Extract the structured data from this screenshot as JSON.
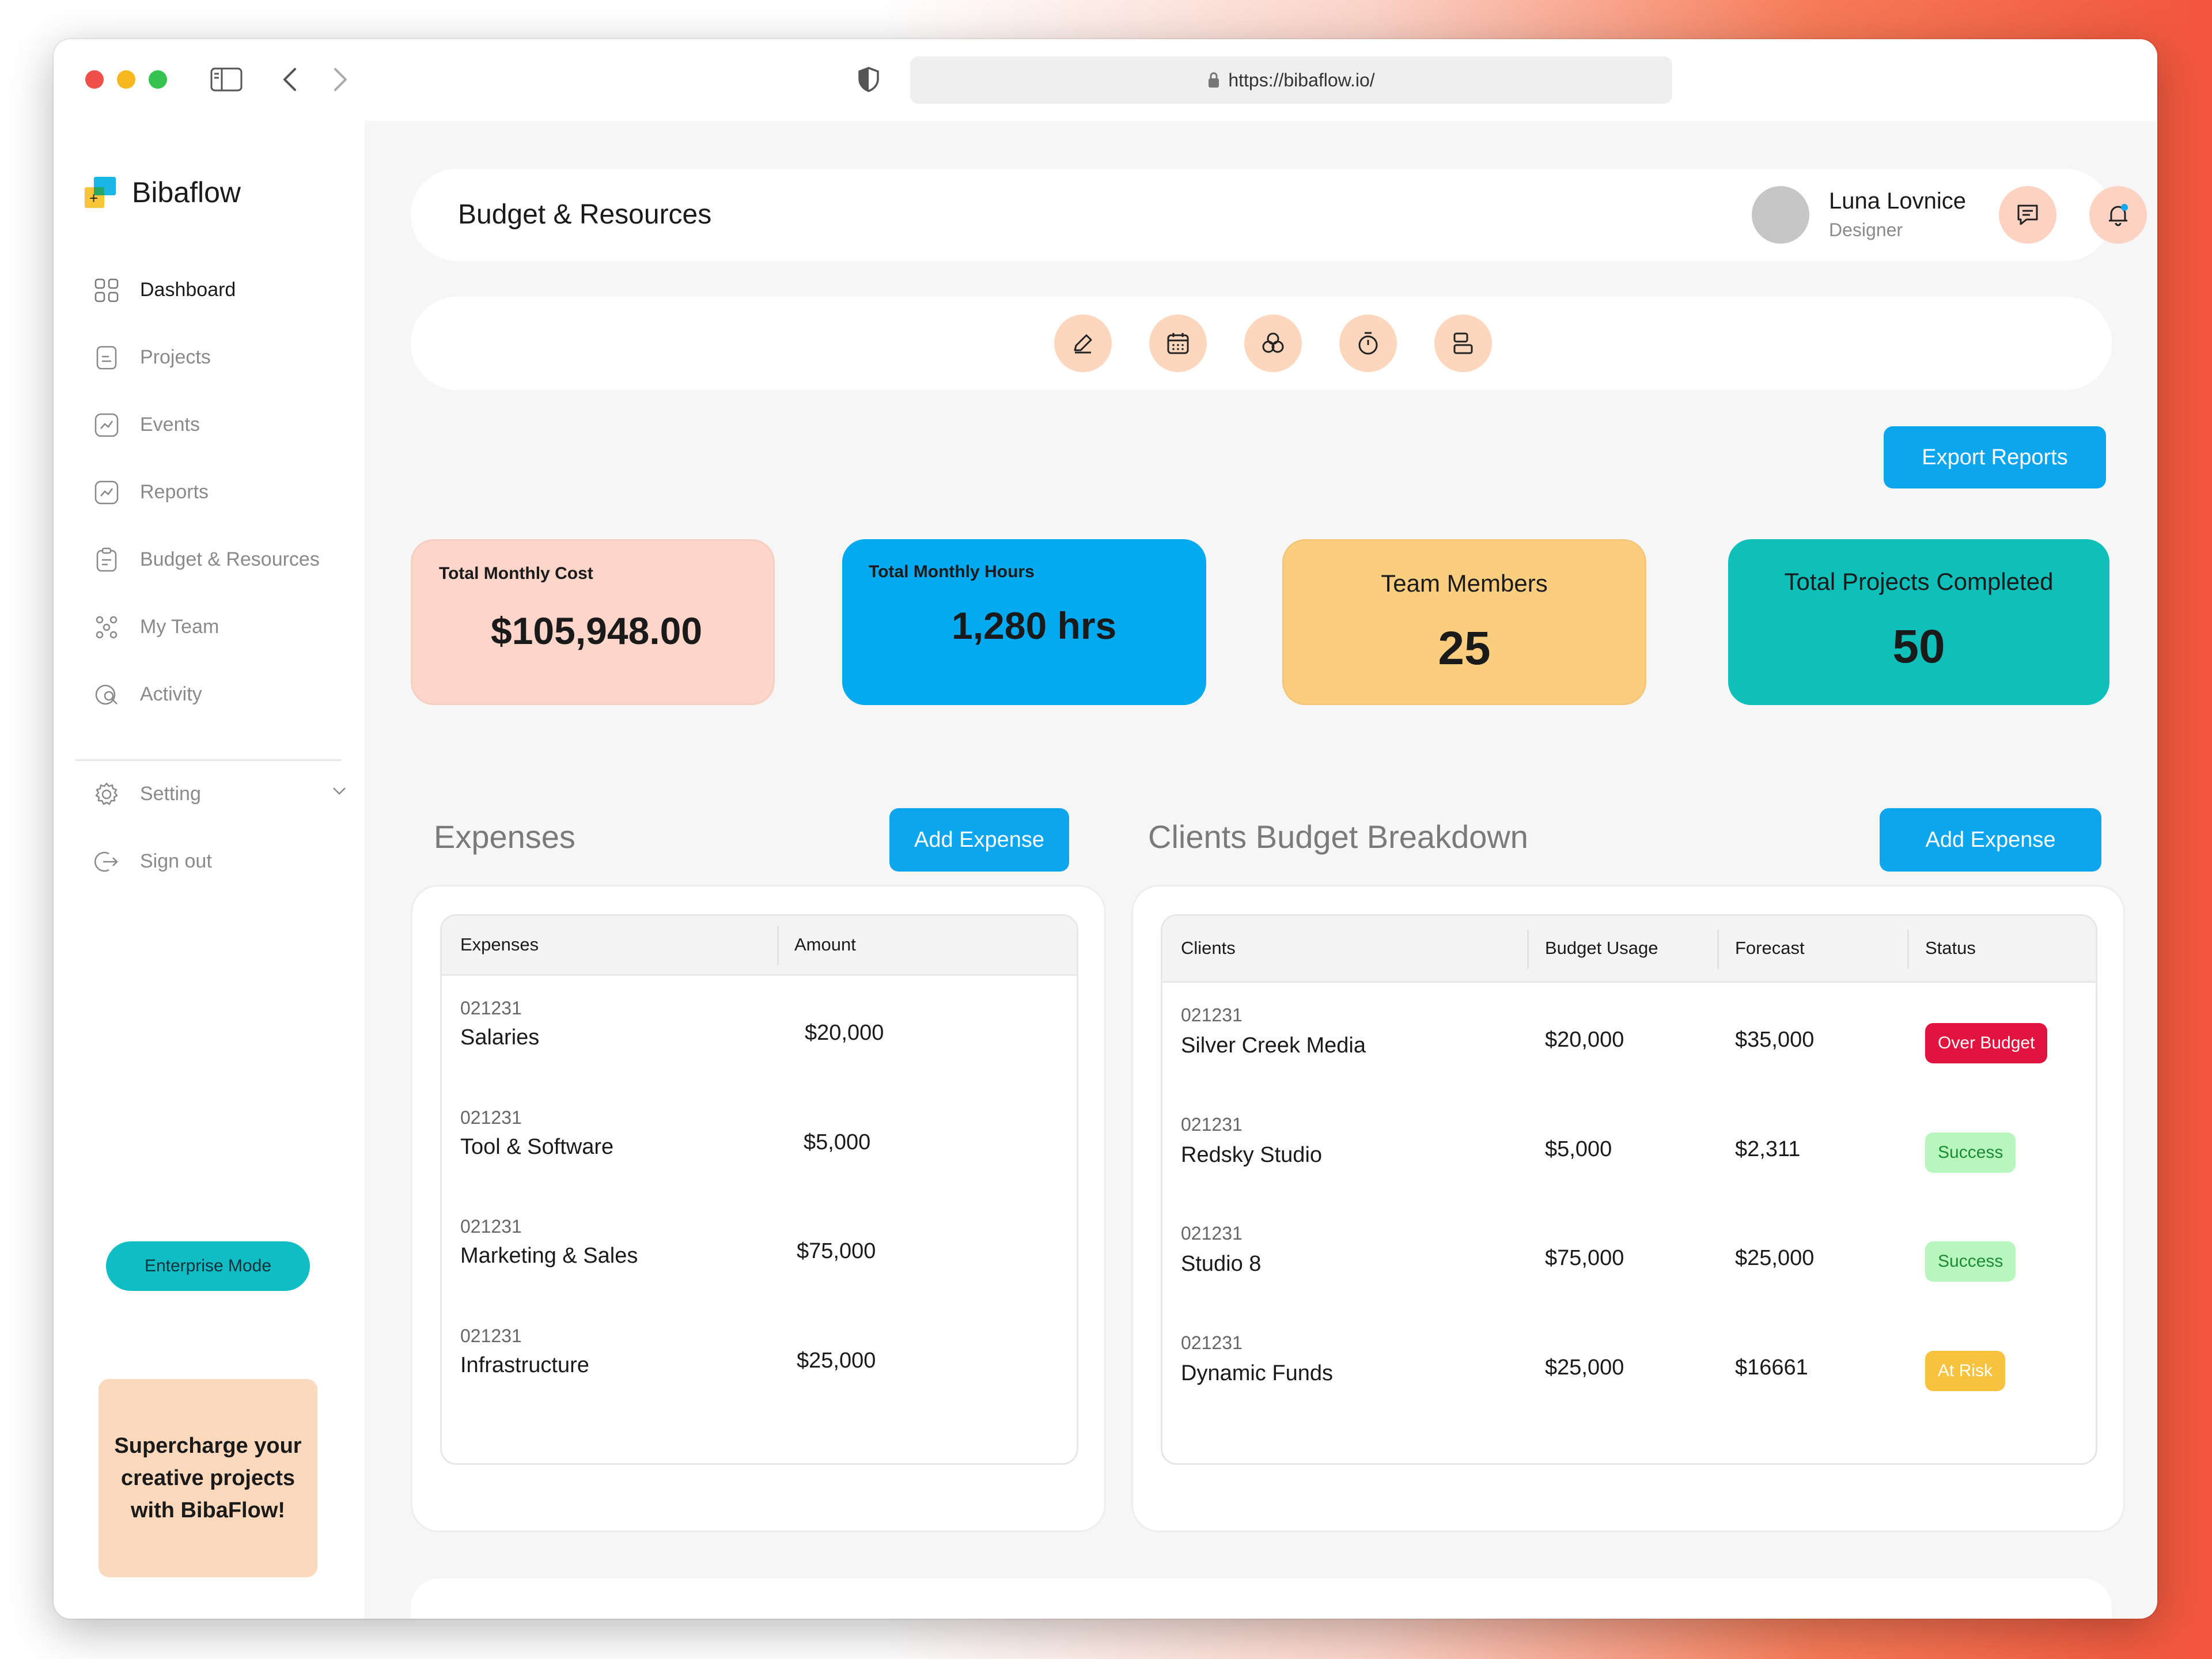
{
  "browser": {
    "url": "https://bibaflow.io/"
  },
  "app": {
    "name": "Bibaflow"
  },
  "sidebar": {
    "items": [
      {
        "label": "Dashboard",
        "icon": "grid-icon",
        "active": true
      },
      {
        "label": "Projects",
        "icon": "document-icon"
      },
      {
        "label": "Events",
        "icon": "chart-icon"
      },
      {
        "label": "Reports",
        "icon": "chart-icon"
      },
      {
        "label": "Budget & Resources",
        "icon": "clipboard-icon"
      },
      {
        "label": "My Team",
        "icon": "team-icon"
      },
      {
        "label": "Activity",
        "icon": "activity-icon"
      }
    ],
    "setting_label": "Setting",
    "signout_label": "Sign out",
    "enterprise_label": "Enterprise Mode",
    "promo_text": "Supercharge your creative projects with BibaFlow!"
  },
  "header": {
    "title": "Budget & Resources",
    "user_name": "Luna Lovnice",
    "user_role": "Designer"
  },
  "toolbar": {
    "icons": [
      "pencil-icon",
      "calendar-icon",
      "circles-icon",
      "timer-icon",
      "layout-icon"
    ]
  },
  "export_label": "Export Reports",
  "stats": {
    "monthly_cost_label": "Total Monthly Cost",
    "monthly_cost_value": "$105,948.00",
    "monthly_hours_label": "Total Monthly Hours",
    "monthly_hours_value": "1,280 hrs",
    "team_label": "Team Members",
    "team_value": "25",
    "projects_label": "Total Projects Completed",
    "projects_value": "50"
  },
  "colors": {
    "accent_blue": "#0ba6ee",
    "teal": "#10bdc5",
    "peach": "#fdd5c9",
    "sky": "#03aaf0",
    "yellow": "#fbcd7e",
    "turquoise": "#0fbfba"
  },
  "expenses": {
    "title": "Expenses",
    "add_label": "Add Expense",
    "columns": [
      "Expenses",
      "Amount"
    ],
    "rows": [
      {
        "id": "021231",
        "name": "Salaries",
        "amount": "$20,000"
      },
      {
        "id": "021231",
        "name": "Tool & Software",
        "amount": "$5,000"
      },
      {
        "id": "021231",
        "name": "Marketing & Sales",
        "amount": "$75,000"
      },
      {
        "id": "021231",
        "name": "Infrastructure",
        "amount": "$25,000"
      }
    ]
  },
  "clients": {
    "title": "Clients Budget Breakdown",
    "add_label": "Add Expense",
    "columns": [
      "Clients",
      "Budget Usage",
      "Forecast",
      "Status"
    ],
    "rows": [
      {
        "id": "021231",
        "name": "Silver Creek Media",
        "usage": "$20,000",
        "forecast": "$35,000",
        "status": "Over Budget"
      },
      {
        "id": "021231",
        "name": "Redsky Studio",
        "usage": "$5,000",
        "forecast": "$2,311",
        "status": "Success"
      },
      {
        "id": "021231",
        "name": "Studio 8",
        "usage": "$75,000",
        "forecast": "$25,000",
        "status": "Success"
      },
      {
        "id": "021231",
        "name": "Dynamic Funds",
        "usage": "$25,000",
        "forecast": "$16661",
        "status": "At Risk"
      }
    ]
  }
}
